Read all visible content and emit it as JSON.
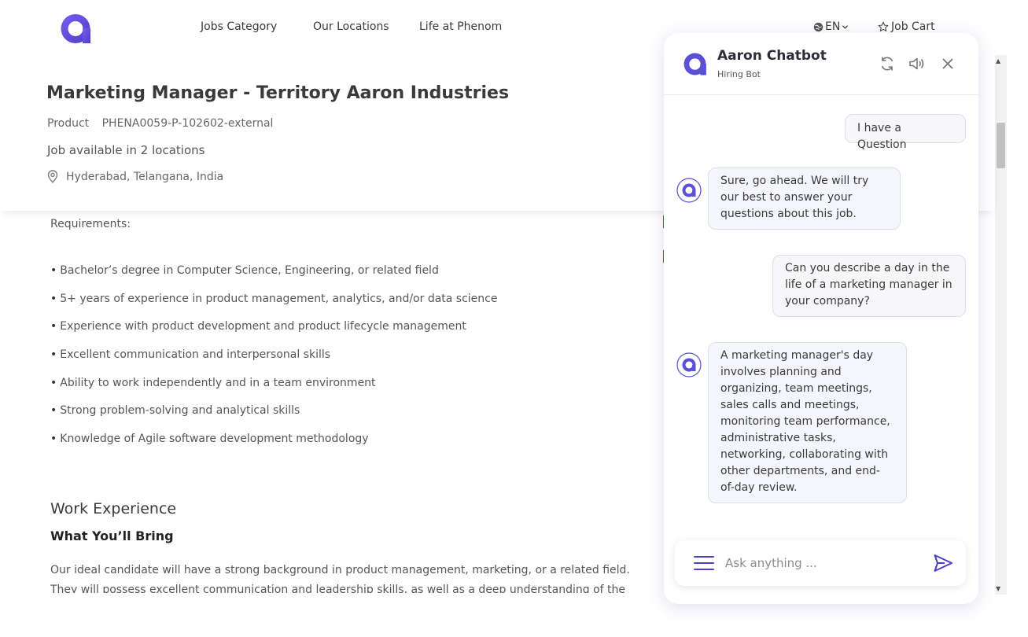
{
  "nav": {
    "links": [
      "Jobs Category",
      "Our Locations",
      "Life at Phenom"
    ],
    "language": "EN",
    "job_cart": "Job Cart"
  },
  "job": {
    "title": "Marketing Manager - Territory Aaron Industries",
    "category_label": "Product",
    "job_id": "PHENA0059-P-102602-external",
    "availability": "Job available in 2 locations",
    "location": "Hyderabad, Telangana, India"
  },
  "content": {
    "requirements_heading": "Requirements:",
    "requirements": [
      "Bachelor’s degree in Computer Science, Engineering, or related field",
      "5+ years of experience in product management, analytics, and/or data science",
      "Experience with product development and product lifecycle management",
      "Excellent communication and interpersonal skills",
      "Ability to work independently and in a team environment",
      "Strong problem-solving and analytical skills",
      "Knowledge of Agile software development methodology"
    ],
    "work_experience_heading": "Work Experience",
    "bring_heading": "What You’ll Bring",
    "description": "Our ideal candidate will have a strong background in product management, marketing, or a related field. They will possess excellent communication and leadership skills, as well as a deep understanding of the web"
  },
  "chatbot": {
    "title": "Aaron Chatbot",
    "subtitle": "Hiring Bot",
    "messages": [
      {
        "from": "user",
        "text": "I have a Question"
      },
      {
        "from": "bot",
        "text": "Sure, go ahead. We will try our best to answer your questions about this job."
      },
      {
        "from": "user",
        "text": "Can you describe a day in the life of a marketing manager in your company?"
      },
      {
        "from": "bot",
        "text": "A marketing manager's day involves planning and organizing, team meetings, sales calls and meetings, monitoring team performance, administrative tasks, networking, collaborating with other departments, and end-of-day review."
      }
    ],
    "input_placeholder": "Ask anything ..."
  },
  "colors": {
    "brand": "#5b4fd6",
    "text": "#3a3a3a"
  }
}
